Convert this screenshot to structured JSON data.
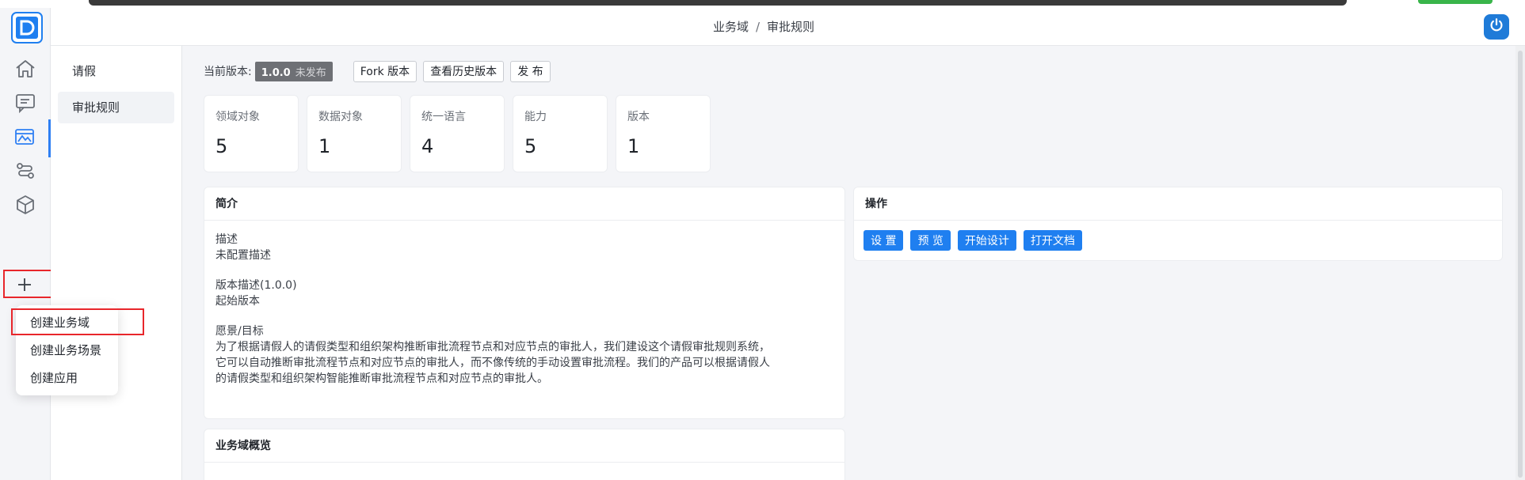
{
  "colors": {
    "accent": "#1f7ff0",
    "highlight_border": "#e8262b",
    "badge": "#6e7075"
  },
  "header": {
    "breadcrumb": [
      "业务域",
      "审批规则"
    ],
    "separator": "/",
    "power_icon": "power-icon"
  },
  "rail": {
    "icons": [
      "home-icon",
      "chat-icon",
      "image-icon",
      "workflow-icon",
      "cube-icon",
      "plus-icon"
    ]
  },
  "subnav": {
    "items": [
      {
        "label": "请假"
      },
      {
        "label": "审批规则"
      }
    ]
  },
  "popup": {
    "items": [
      {
        "label": "创建业务域"
      },
      {
        "label": "创建业务场景"
      },
      {
        "label": "创建应用"
      }
    ]
  },
  "version": {
    "label": "当前版本:",
    "number": "1.0.0",
    "status": "未发布",
    "fork_label": "Fork 版本",
    "history_label": "查看历史版本",
    "publish_label": "发 布"
  },
  "stats": [
    {
      "label": "领域对象",
      "value": "5"
    },
    {
      "label": "数据对象",
      "value": "1"
    },
    {
      "label": "统一语言",
      "value": "4"
    },
    {
      "label": "能力",
      "value": "5"
    },
    {
      "label": "版本",
      "value": "1"
    }
  ],
  "intro": {
    "title": "简介",
    "desc_label": "描述",
    "desc_value": "未配置描述",
    "version_desc_label": "版本描述(1.0.0)",
    "version_desc_value": "起始版本",
    "vision_label": "愿景/目标",
    "vision_lines": [
      "为了根据请假人的请假类型和组织架构推断审批流程节点和对应节点的审批人，我们建设这个请假审批规则系统，",
      "它可以自动推断审批流程节点和对应节点的审批人，而不像传统的手动设置审批流程。我们的产品可以根据请假人",
      "的请假类型和组织架构智能推断审批流程节点和对应节点的审批人。"
    ]
  },
  "ops": {
    "title": "操作",
    "buttons": [
      "设 置",
      "预 览",
      "开始设计",
      "打开文档"
    ]
  },
  "overview": {
    "title": "业务域概览"
  }
}
